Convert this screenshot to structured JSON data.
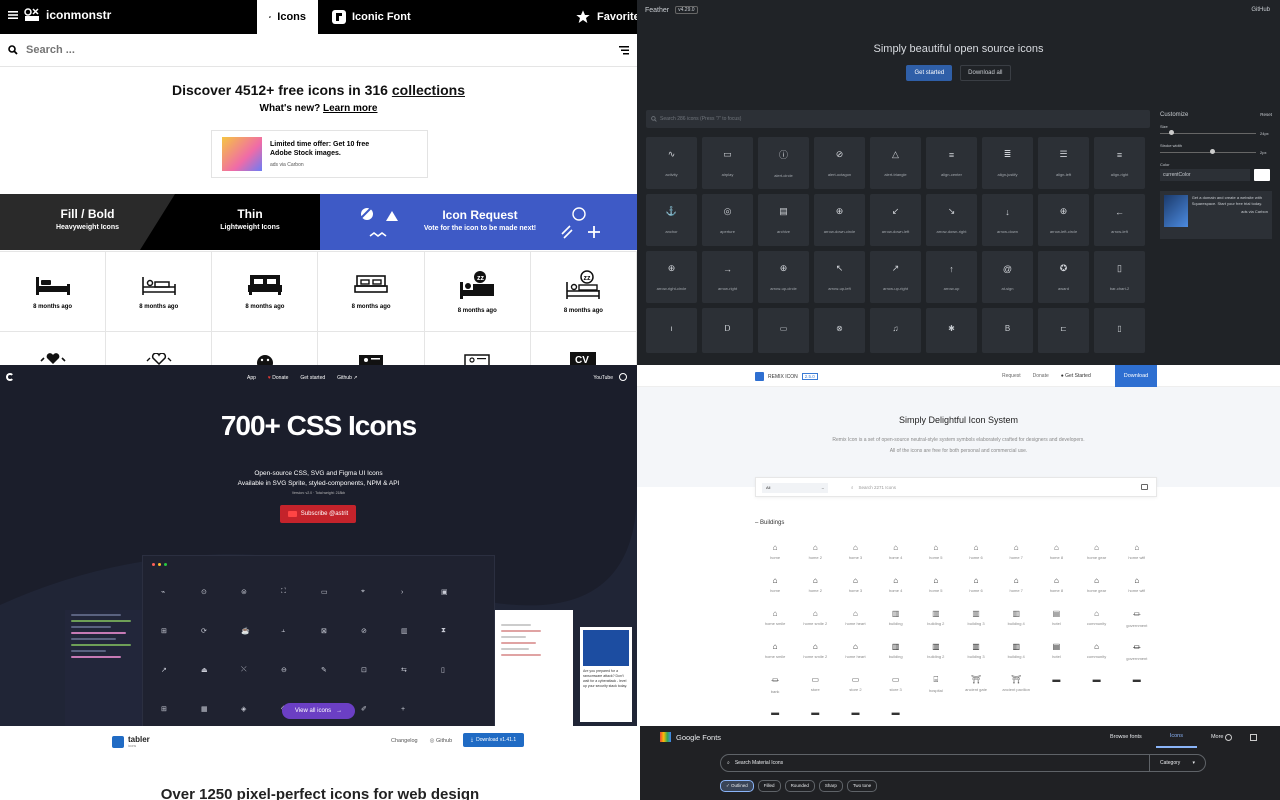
{
  "iconmonstr": {
    "brand": "iconmonstr",
    "tabs": [
      "Icons",
      "Iconic Font"
    ],
    "favorites": "Favorites",
    "search_placeholder": "Search ...",
    "headline_pre": "Discover 4512+ free icons in 316 ",
    "headline_link": "collections",
    "whats_new_pre": "What's new? ",
    "whats_new_link": "Learn more",
    "ad": {
      "brand": "Adobe Stock",
      "text": "Limited time offer: Get 10 free Adobe Stock images.",
      "via": "ads via Carbon"
    },
    "banner": {
      "fill_title": "Fill / Bold",
      "fill_sub": "Heavyweight Icons",
      "thin_title": "Thin",
      "thin_sub": "Lightweight Icons",
      "req_title": "Icon Request",
      "req_sub": "Vote for the icon to be made next!"
    },
    "icons": [
      {
        "icon": "bed-icon",
        "label": "8 months ago"
      },
      {
        "icon": "bed-person-icon",
        "label": "8 months ago"
      },
      {
        "icon": "bed-double-icon",
        "label": "8 months ago"
      },
      {
        "icon": "bed-outline-icon",
        "label": "8 months ago"
      },
      {
        "icon": "sleep-icon",
        "label": "8 months ago"
      },
      {
        "icon": "sleep-outline-icon",
        "label": "8 months ago"
      }
    ]
  },
  "feather": {
    "brand": "Feather",
    "version": "v4.29.0",
    "github": "GitHub",
    "tagline": "Simply beautiful open source icons",
    "get_started": "Get started",
    "download_all": "Download all",
    "search_placeholder": "Search 286 icons (Press \"/\" to focus)",
    "icons": [
      "activity",
      "airplay",
      "alert-circle",
      "alert-octagon",
      "alert-triangle",
      "align-center",
      "align-justify",
      "align-left",
      "align-right",
      "anchor",
      "aperture",
      "archive",
      "arrow-down-circle",
      "arrow-down-left",
      "arrow-down-right",
      "arrow-down",
      "arrow-left-circle",
      "arrow-left",
      "arrow-right-circle",
      "arrow-right",
      "arrow-up-circle",
      "arrow-up-left",
      "arrow-up-right",
      "arrow-up",
      "at-sign",
      "award",
      "bar-chart-2"
    ],
    "customize": {
      "title": "Customize",
      "reset": "Reset",
      "size_label": "Size",
      "size_value": "24px",
      "size_level": 0.1,
      "stroke_label": "Stroke width",
      "stroke_value": "2px",
      "stroke_level": 0.55,
      "color_label": "Color",
      "color_value": "currentColor"
    },
    "ad": {
      "text": "Get a domain and create a website with Squarespace. Start your free trial today.",
      "via": "ads via Carbon"
    }
  },
  "cssgg": {
    "nav": [
      "App",
      "Donate",
      "Get started",
      "Github"
    ],
    "youtube": "YouTube",
    "title": "700+ CSS Icons",
    "sub1": "Open-source CSS, SVG and Figma UI Icons",
    "sub2": "Available in SVG Sprite, styled-components, NPM & API",
    "version": "Version: v2.0 · Total weight: 218kb",
    "subscribe": "Subscribe @astrit",
    "view_all": "View all icons",
    "ad": "Are you prepared for a ransomware attack? Don't wait for a cyberattack - level up your security stack today."
  },
  "remix": {
    "brand": "REMIX ICON",
    "version": "2.5.0",
    "links": [
      "Request",
      "Donate",
      "Get Started"
    ],
    "download": "Download",
    "title": "Simply Delightful Icon System",
    "desc1": "Remix Icon is a set of open-source neutral-style system symbols elaborately crafted for designers and developers.",
    "desc2": "All of the icons are free for both personal and commercial use.",
    "filter": "All",
    "search_placeholder": "Search 2271 Icons",
    "category": "Buildings",
    "icons": [
      "home",
      "home 2",
      "home 3",
      "home 4",
      "home 5",
      "home 6",
      "home 7",
      "home 8",
      "home gear",
      "home wifi",
      "home",
      "home 2",
      "home 3",
      "home 4",
      "home 5",
      "home 6",
      "home 7",
      "home 8",
      "home gear",
      "home wifi",
      "home smile",
      "home smile 2",
      "home heart",
      "building",
      "building 2",
      "building 3",
      "building 4",
      "hotel",
      "community",
      "government",
      "home smile",
      "home smile 2",
      "home heart",
      "building",
      "building 2",
      "building 3",
      "building 4",
      "hotel",
      "community",
      "government",
      "bank",
      "store",
      "store 2",
      "store 3",
      "hospital",
      "ancient gate",
      "ancient pavilion"
    ]
  },
  "tabler": {
    "brand": "tabler",
    "brand_sub": "icons",
    "links": [
      "Changelog",
      "Github"
    ],
    "download": "Download v1.41.1",
    "title": "Over 1250 pixel-perfect icons for web design"
  },
  "gfonts": {
    "brand": "Google Fonts",
    "nav": [
      "Browse fonts",
      "Icons",
      "More"
    ],
    "search_placeholder": "Search Material Icons",
    "category": "Category",
    "chips": [
      "Outlined",
      "Filled",
      "Rounded",
      "Sharp",
      "Two tone"
    ]
  }
}
